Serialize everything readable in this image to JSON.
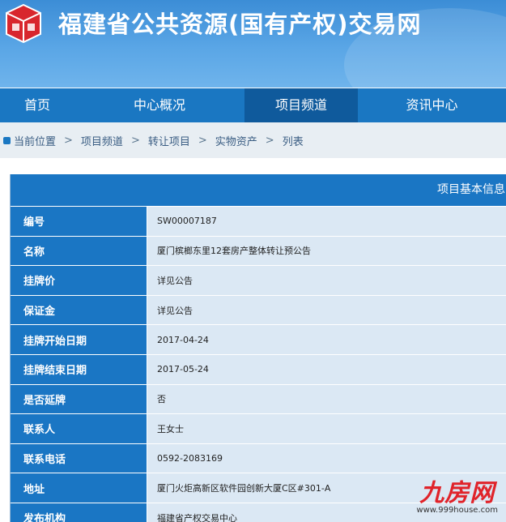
{
  "header": {
    "site_title": "福建省公共资源(国有产权)交易网",
    "logo_icon": "building-cube-logo"
  },
  "nav": {
    "items": [
      {
        "label": "首页"
      },
      {
        "label": "中心概况"
      },
      {
        "label": "项目频道"
      },
      {
        "label": "资讯中心"
      }
    ],
    "active": "项目频道"
  },
  "breadcrumb": {
    "items": [
      "当前位置",
      "项目频道",
      "转让项目",
      "实物资产",
      "列表"
    ],
    "separator": ">"
  },
  "info": {
    "title": "项目基本信息",
    "rows": [
      {
        "label": "编号",
        "value": "SW00007187"
      },
      {
        "label": "名称",
        "value": "厦门槟榔东里12套房产整体转让预公告"
      },
      {
        "label": "挂牌价",
        "value": "详见公告"
      },
      {
        "label": "保证金",
        "value": "详见公告"
      },
      {
        "label": "挂牌开始日期",
        "value": "2017-04-24"
      },
      {
        "label": "挂牌结束日期",
        "value": "2017-05-24"
      },
      {
        "label": "是否延牌",
        "value": "否"
      },
      {
        "label": "联系人",
        "value": "王女士"
      },
      {
        "label": "联系电话",
        "value": "0592-2083169"
      },
      {
        "label": "地址",
        "value": "厦门火炬高新区软件园创新大厦C区#301-A"
      },
      {
        "label": "发布机构",
        "value": "福建省产权交易中心"
      }
    ]
  },
  "watermark": {
    "logo_text": "九房网",
    "url": "www.999house.com"
  },
  "colors": {
    "primary": "#1a76c4",
    "nav_active": "#0f5a9c",
    "value_bg": "#dbe8f4",
    "watermark": "#e0232a"
  }
}
